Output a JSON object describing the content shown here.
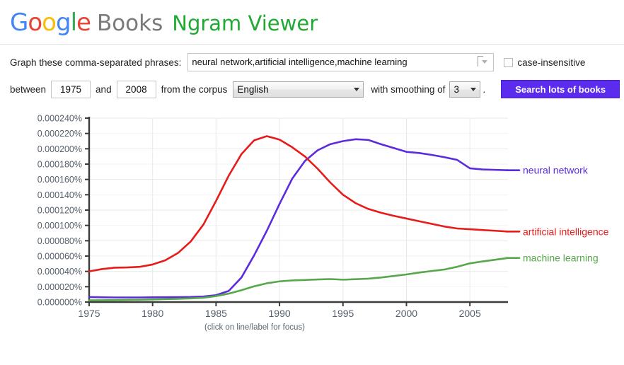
{
  "header": {
    "logo_google_letters": [
      {
        "char": "G",
        "color": "#4285f4"
      },
      {
        "char": "o",
        "color": "#ea4335"
      },
      {
        "char": "o",
        "color": "#fbbc05"
      },
      {
        "char": "g",
        "color": "#4285f4"
      },
      {
        "char": "l",
        "color": "#34a853"
      },
      {
        "char": "e",
        "color": "#ea4335"
      }
    ],
    "logo_books": "Books",
    "logo_ngram": "Ngram Viewer"
  },
  "query": {
    "label": "Graph these comma-separated phrases:",
    "phrases_value": "neural network,artificial intelligence,machine learning",
    "phrases_placeholder": "",
    "dropdown_icon": "chevron-down-icon",
    "case_insensitive_label": "case-insensitive",
    "case_insensitive_checked": false
  },
  "options": {
    "between_label": "between",
    "year_start": "1975",
    "and_label": "and",
    "year_end": "2008",
    "corpus_label": "from the corpus",
    "corpus_value": "English",
    "smoothing_label": "with smoothing of",
    "smoothing_value": "3",
    "period": ".",
    "search_button": "Search lots of books"
  },
  "chart_footnote": "(click on line/label for focus)",
  "colors": {
    "neural_network": "#5b2bde",
    "artificial_intelligence": "#e81b1b",
    "machine_learning": "#56a84b",
    "button": "#5b2bee",
    "ngram_green": "#1faa33"
  },
  "chart_data": {
    "type": "line",
    "title": "",
    "xlabel": "",
    "ylabel": "",
    "xlim": [
      1975,
      2008
    ],
    "ylim": [
      0.0,
      0.00024
    ],
    "grid": true,
    "legend_position": "right-inline-labels",
    "xticks": [
      1975,
      1980,
      1985,
      1990,
      1995,
      2000,
      2005
    ],
    "xtick_labels": [
      "1975",
      "1980",
      "1985",
      "1990",
      "1995",
      "2000",
      "2005"
    ],
    "yticks": [
      0.0,
      2e-05,
      4e-05,
      6e-05,
      8e-05,
      0.0001,
      0.00012,
      0.00014,
      0.00016,
      0.00018,
      0.0002,
      0.00022,
      0.00024
    ],
    "ytick_labels": [
      "0.000000%",
      "0.000020%",
      "0.000040%",
      "0.000060%",
      "0.000080%",
      "0.000100%",
      "0.000120%",
      "0.000140%",
      "0.000160%",
      "0.000180%",
      "0.000200%",
      "0.000220%",
      "0.000240%"
    ],
    "x": [
      1975,
      1976,
      1977,
      1978,
      1979,
      1980,
      1981,
      1982,
      1983,
      1984,
      1985,
      1986,
      1987,
      1988,
      1989,
      1990,
      1991,
      1992,
      1993,
      1994,
      1995,
      1996,
      1997,
      1998,
      1999,
      2000,
      2001,
      2002,
      2003,
      2004,
      2005,
      2006,
      2007,
      2008
    ],
    "series": [
      {
        "name": "neural network",
        "color": "#5b2bde",
        "label": "neural network",
        "values": [
          6.5e-06,
          6.2e-06,
          6e-06,
          6e-06,
          6e-06,
          6.2e-06,
          6.3e-06,
          6.4e-06,
          6.6e-06,
          7.2e-06,
          9e-06,
          1.45e-05,
          3.2e-05,
          6.1e-05,
          9.3e-05,
          0.000128,
          0.000161,
          0.000184,
          0.000198,
          0.000206,
          0.00021,
          0.0002125,
          0.0002115,
          0.000206,
          0.000201,
          0.000196,
          0.0001945,
          0.000192,
          0.000189,
          0.0001855,
          0.0001745,
          0.000173,
          0.0001725,
          0.000172
        ]
      },
      {
        "name": "artificial intelligence",
        "color": "#e81b1b",
        "label": "artificial intelligence",
        "values": [
          4e-05,
          4.3e-05,
          4.48e-05,
          4.52e-05,
          4.6e-05,
          4.9e-05,
          5.45e-05,
          6.4e-05,
          7.9e-05,
          0.000101,
          0.000132,
          0.000165,
          0.000193,
          0.000211,
          0.0002165,
          0.000212,
          0.000202,
          0.00019,
          0.000174,
          0.000156,
          0.00014,
          0.000129,
          0.0001215,
          0.0001165,
          0.0001125,
          0.000109,
          0.0001055,
          0.000102,
          9.85e-05,
          9.6e-05,
          9.5e-05,
          9.4e-05,
          9.3e-05,
          9.2e-05
        ]
      },
      {
        "name": "machine learning",
        "color": "#56a84b",
        "label": "machine learning",
        "values": [
          2.2e-06,
          2.4e-06,
          2.6e-06,
          2.8e-06,
          3e-06,
          3.4e-06,
          3.8e-06,
          4.2e-06,
          4.8e-06,
          5.6e-06,
          7.8e-06,
          1.1e-05,
          1.55e-05,
          2.05e-05,
          2.45e-05,
          2.7e-05,
          2.82e-05,
          2.88e-05,
          2.95e-05,
          3e-05,
          2.92e-05,
          2.98e-05,
          3.05e-05,
          3.2e-05,
          3.4e-05,
          3.6e-05,
          3.85e-05,
          4.05e-05,
          4.25e-05,
          4.6e-05,
          5.05e-05,
          5.3e-05,
          5.52e-05,
          5.75e-05
        ]
      }
    ]
  }
}
